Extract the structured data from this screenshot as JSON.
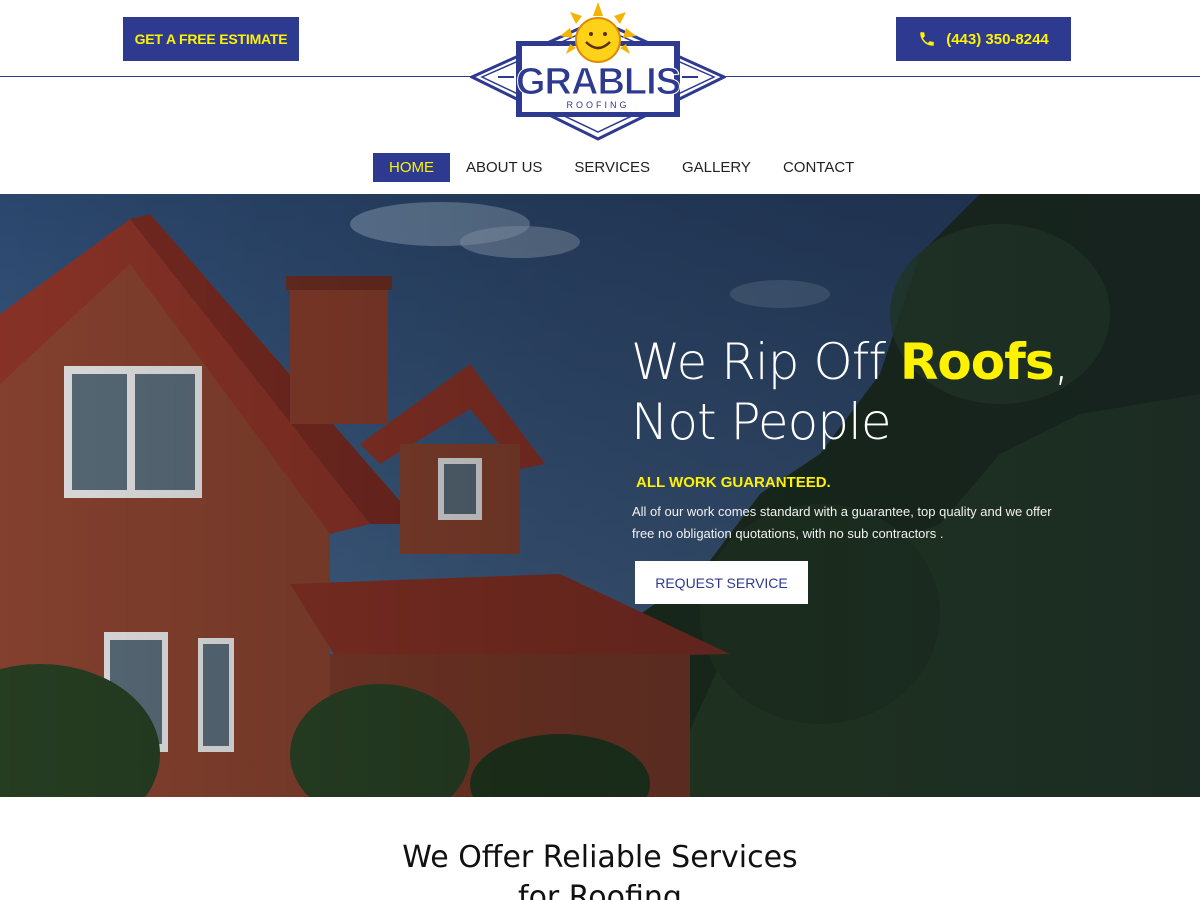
{
  "header": {
    "estimate_label": "GET A FREE ESTIMATE",
    "phone_label": "(443) 350-8244",
    "phone_icon": "phone-icon"
  },
  "logo": {
    "name": "GRABLIS",
    "tagline": "ROOFING"
  },
  "nav": {
    "items": [
      {
        "label": "HOME",
        "active": true
      },
      {
        "label": "ABOUT US",
        "active": false
      },
      {
        "label": "SERVICES",
        "active": false
      },
      {
        "label": "GALLERY",
        "active": false
      },
      {
        "label": "CONTACT",
        "active": false
      }
    ]
  },
  "hero": {
    "title_part1": "We Rip Off ",
    "title_highlight": "Roofs",
    "title_part2": ",",
    "title_line2": "Not People",
    "guarantee": "ALL WORK GUARANTEED.",
    "description": "All of our work comes standard with a guarantee, top quality and we offer free no obligation quotations, with no sub contractors .",
    "cta_label": "REQUEST SERVICE"
  },
  "services": {
    "heading_line1": "We Offer Reliable Services",
    "heading_line2": "for Roofing"
  },
  "colors": {
    "brand_blue": "#2e3a8f",
    "accent_yellow": "#fff200"
  }
}
